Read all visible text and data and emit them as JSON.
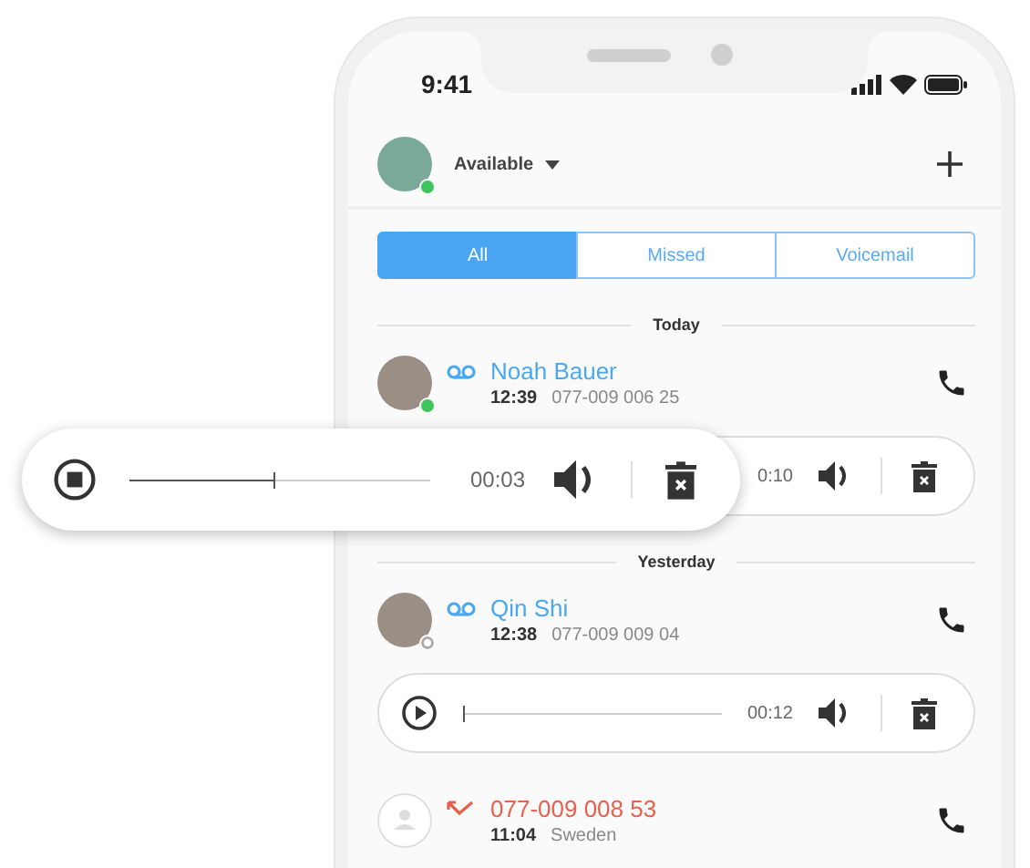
{
  "status_bar": {
    "time": "9:41"
  },
  "header": {
    "status": "Available"
  },
  "tabs": [
    {
      "label": "All",
      "selected": true
    },
    {
      "label": "Missed",
      "selected": false
    },
    {
      "label": "Voicemail",
      "selected": false
    }
  ],
  "sections": [
    {
      "title": "Today",
      "calls": [
        {
          "kind": "voicemail",
          "name": "Noah Bauer",
          "time": "12:39",
          "detail": "077-009 006 25",
          "online": true,
          "player": {
            "time": "0:10"
          }
        }
      ]
    },
    {
      "title": "Yesterday",
      "calls": [
        {
          "kind": "voicemail",
          "name": "Qin Shi",
          "time": "12:38",
          "detail": "077-009 009 04",
          "online": false,
          "player": {
            "playing": false,
            "level": 0,
            "time": "00:12"
          }
        },
        {
          "kind": "missed",
          "name": "077-009 008 53",
          "time": "11:04",
          "detail": "Sweden"
        }
      ]
    }
  ],
  "floating_player": {
    "playing": true,
    "level": 0.48,
    "time": "00:03"
  }
}
